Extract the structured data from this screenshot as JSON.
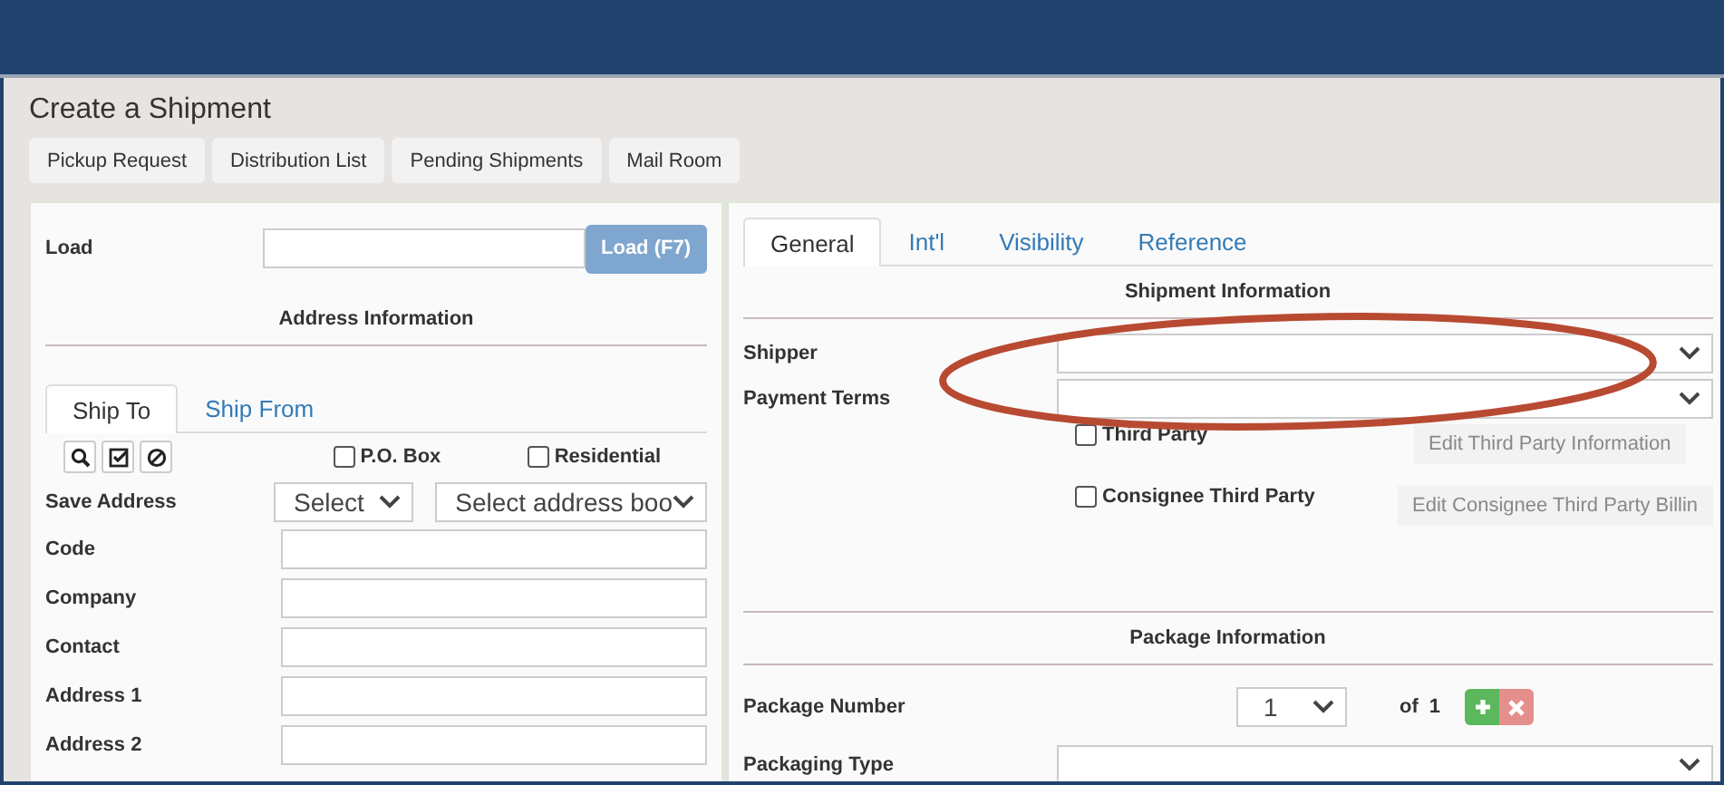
{
  "page": {
    "title": "Create a Shipment"
  },
  "toolbar": [
    {
      "label": "Pickup Request"
    },
    {
      "label": "Distribution List"
    },
    {
      "label": "Pending Shipments"
    },
    {
      "label": "Mail Room"
    }
  ],
  "left": {
    "load": {
      "label": "Load",
      "button": "Load (F7)"
    },
    "section_title": "Address Information",
    "tabs": [
      {
        "label": "Ship To",
        "selected": true
      },
      {
        "label": "Ship From",
        "selected": false
      }
    ],
    "tools": [
      {
        "kind": "search"
      },
      {
        "kind": "check"
      },
      {
        "kind": "clear"
      }
    ],
    "checkboxes": [
      {
        "label": "P.O. Box",
        "checked": false
      },
      {
        "label": "Residential",
        "checked": false
      }
    ],
    "save_address": {
      "label": "Save Address",
      "select": "Select",
      "address_book": "Select address boo"
    },
    "fields": [
      {
        "label": "Code"
      },
      {
        "label": "Company"
      },
      {
        "label": "Contact"
      },
      {
        "label": "Address 1"
      },
      {
        "label": "Address 2"
      }
    ]
  },
  "right": {
    "tabs": [
      {
        "label": "General",
        "selected": true
      },
      {
        "label": "Int'l",
        "selected": false
      },
      {
        "label": "Visibility",
        "selected": false
      },
      {
        "label": "Reference",
        "selected": false
      }
    ],
    "section_title": "Shipment Information",
    "selects": [
      {
        "label": "Shipper"
      },
      {
        "label": "Payment Terms"
      }
    ],
    "options": [
      {
        "label": "Third Party",
        "checked": false,
        "button": "Edit Third Party Information",
        "disabled": true
      },
      {
        "label": "Consignee Third Party",
        "checked": false,
        "button": "Edit Consignee Third Party Billin",
        "disabled": true
      }
    ],
    "package_title": "Package Information",
    "package_number": {
      "label": "Package Number",
      "value": "1",
      "of": "of",
      "total": "1"
    },
    "packaging_type": {
      "label": "Packaging Type"
    }
  },
  "annotation": {
    "kind": "ellipse"
  }
}
